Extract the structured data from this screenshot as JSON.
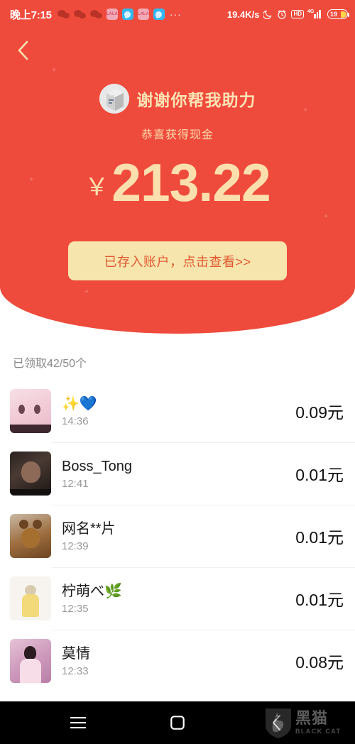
{
  "statusbar": {
    "time": "晚上7:15",
    "app_icons": [
      {
        "name": "wechat-icon",
        "label": ""
      },
      {
        "name": "wechat-icon",
        "label": ""
      },
      {
        "name": "wechat-icon",
        "label": ""
      },
      {
        "name": "lala-app-icon",
        "label": "LALA"
      },
      {
        "name": "blue-app-icon",
        "label": ""
      },
      {
        "name": "lala-app-icon",
        "label": "LALA"
      },
      {
        "name": "blue-app-icon",
        "label": ""
      }
    ],
    "overflow_dots": "···",
    "network_speed": "19.4K/s",
    "do_not_disturb_icon": "☾",
    "alarm_icon": "⏰",
    "hd_badge": "HD",
    "network_type": "4G",
    "battery_percent": "19"
  },
  "header": {
    "back_icon": "chevron-left-icon",
    "avatar_alt": "cube-avatar",
    "title": "谢谢你帮我助力",
    "subtitle": "恭喜获得现金",
    "currency_symbol": "￥",
    "amount": "213.22",
    "cta_label": "已存入账户，点击查看>>",
    "background_color": "#ef4b3c",
    "accent_color": "#fbe0ae",
    "cta_bg_color": "#f7e5ae",
    "cta_text_color": "#e0582f"
  },
  "list": {
    "header": "已领取42/50个",
    "claimed": 42,
    "total": 50,
    "rows": [
      {
        "avatar": "av-anime",
        "name": "✨💙",
        "time": "14:36",
        "amount": "0.09元"
      },
      {
        "avatar": "av-photo",
        "name": "Boss_Tong",
        "time": "12:41",
        "amount": "0.01元"
      },
      {
        "avatar": "av-bear",
        "name": "网名**片",
        "time": "12:39",
        "amount": "0.01元"
      },
      {
        "avatar": "av-girl",
        "name": "柠萌べ🌿",
        "time": "12:35",
        "amount": "0.01元"
      },
      {
        "avatar": "av-lady",
        "name": "莫情",
        "time": "12:33",
        "amount": "0.08元"
      }
    ]
  },
  "navbar": {
    "menu_icon": "menu-icon",
    "home_icon": "home-square-icon",
    "back_icon": "chevron-left-icon",
    "watermark_cn": "黑猫",
    "watermark_en": "BLACK CAT"
  }
}
